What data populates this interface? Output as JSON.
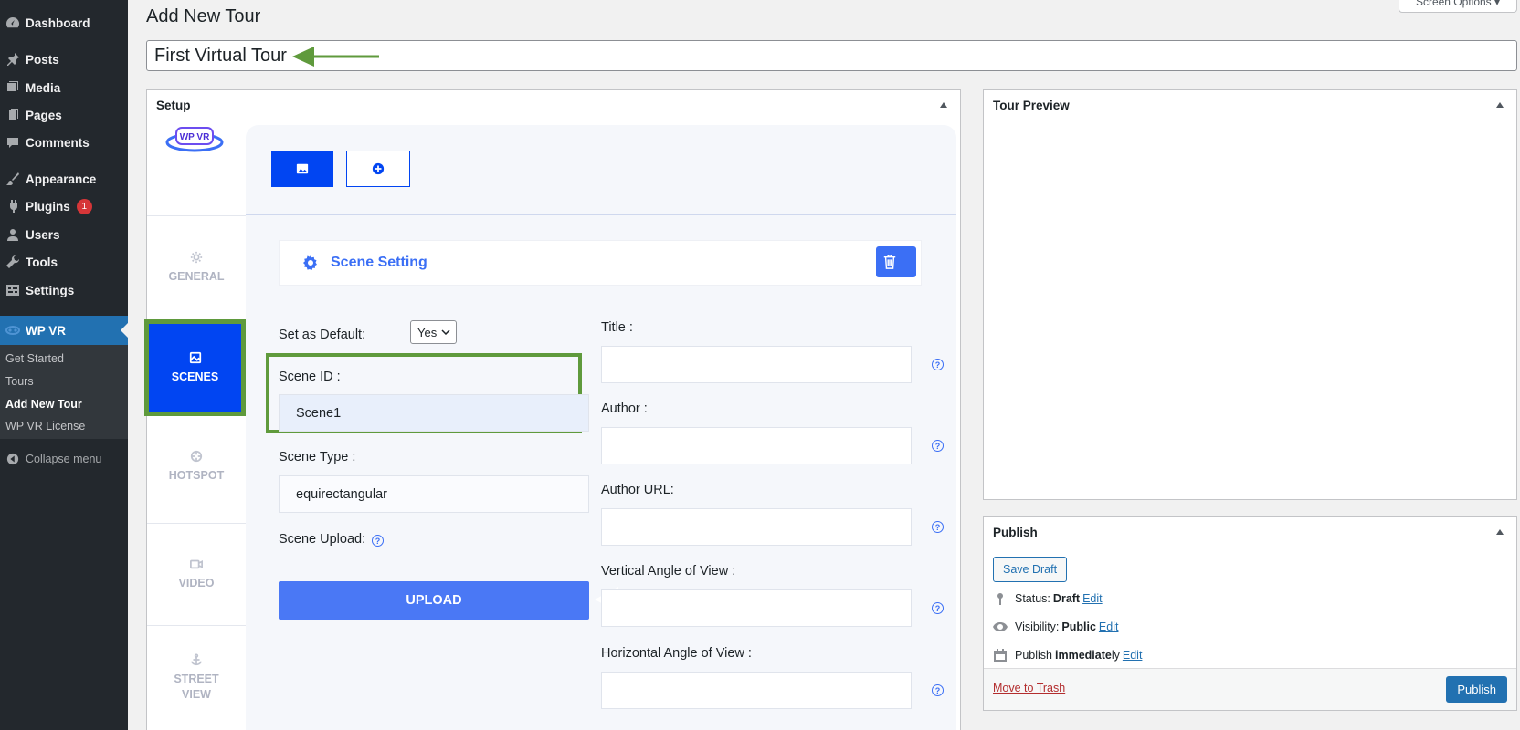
{
  "sidebar": {
    "items": [
      {
        "label": "Dashboard",
        "icon": "dashboard-icon"
      },
      {
        "label": "Posts",
        "icon": "pin-icon"
      },
      {
        "label": "Media",
        "icon": "media-icon"
      },
      {
        "label": "Pages",
        "icon": "pages-icon"
      },
      {
        "label": "Comments",
        "icon": "comments-icon"
      },
      {
        "label": "Appearance",
        "icon": "brush-icon"
      },
      {
        "label": "Plugins",
        "icon": "plugin-icon",
        "badge": "1"
      },
      {
        "label": "Users",
        "icon": "users-icon"
      },
      {
        "label": "Tools",
        "icon": "wrench-icon"
      },
      {
        "label": "Settings",
        "icon": "settings-icon"
      },
      {
        "label": "WP VR",
        "icon": "vr-icon"
      }
    ],
    "submenu": [
      "Get Started",
      "Tours",
      "Add New Tour",
      "WP VR License"
    ],
    "collapse_label": "Collapse menu"
  },
  "header": {
    "page_title": "Add New Tour",
    "screen_options": "Screen Options ▾",
    "tour_title_value": "First Virtual Tour"
  },
  "setup": {
    "box_title": "Setup",
    "logo_text": "WP VR",
    "tabs": [
      "GENERAL",
      "SCENES",
      "HOTSPOT",
      "VIDEO",
      "STREET VIEW"
    ],
    "scene_setting_title": "Scene Setting",
    "set_default_label": "Set as Default:",
    "set_default_value": "Yes",
    "scene_id_label": "Scene ID :",
    "scene_id_value": "Scene1",
    "scene_type_label": "Scene Type :",
    "scene_type_value": "equirectangular",
    "scene_upload_label": "Scene Upload:",
    "upload_button": "UPLOAD",
    "title_label": "Title :",
    "author_label": "Author :",
    "author_url_label": "Author URL:",
    "vertical_label": "Vertical Angle of View :",
    "horizontal_label": "Horizontal Angle of View :"
  },
  "preview": {
    "box_title": "Tour Preview"
  },
  "publish": {
    "box_title": "Publish",
    "save_draft": "Save Draft",
    "status_label": "Status:",
    "status_value": "Draft",
    "visibility_label": "Visibility:",
    "visibility_value": "Public",
    "publish_prefix": "Publish",
    "publish_value": "immediate",
    "publish_suffix": "ly",
    "edit_link": "Edit",
    "move_to_trash": "Move to Trash",
    "publish_button": "Publish"
  },
  "colors": {
    "sidebar_bg": "#23282d",
    "wp_blue": "#2271b1",
    "vr_blue": "#0145f2",
    "highlight_green": "#5f9a3c"
  }
}
